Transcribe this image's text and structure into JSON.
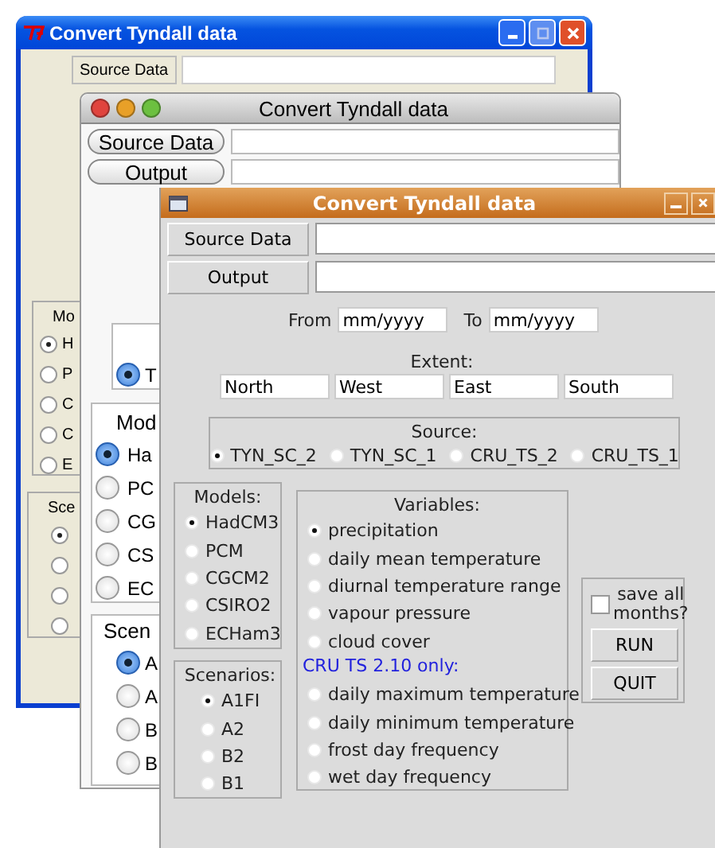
{
  "xp_window": {
    "title": "Convert Tyndall data",
    "source_button": "Source Data",
    "models": {
      "title": "Mo",
      "options": [
        {
          "label": "H",
          "selected": true
        },
        {
          "label": "P",
          "selected": false
        },
        {
          "label": "C",
          "selected": false
        },
        {
          "label": "C",
          "selected": false
        },
        {
          "label": "E",
          "selected": false
        }
      ]
    },
    "scenarios": {
      "title": "Sce",
      "options": [
        {
          "selected": true
        },
        {
          "selected": false
        },
        {
          "selected": false
        },
        {
          "selected": false
        }
      ]
    }
  },
  "mac_window": {
    "title": "Convert Tyndall data",
    "source_button": "Source Data",
    "output_button": "Output",
    "source": {
      "options": [
        {
          "label": "T",
          "selected": true
        }
      ]
    },
    "models": {
      "title": "Mod",
      "options": [
        {
          "label": "Ha",
          "selected": true
        },
        {
          "label": "PC",
          "selected": false
        },
        {
          "label": "CG",
          "selected": false
        },
        {
          "label": "CS",
          "selected": false
        },
        {
          "label": "EC",
          "selected": false
        }
      ]
    },
    "scenarios": {
      "title": "Scen",
      "options": [
        {
          "label": "A",
          "selected": true
        },
        {
          "label": "A",
          "selected": false
        },
        {
          "label": "B",
          "selected": false
        },
        {
          "label": "B",
          "selected": false
        }
      ]
    }
  },
  "main_window": {
    "title": "Convert Tyndall data",
    "source_button": "Source Data",
    "output_button": "Output",
    "from_label": "From",
    "from_value": "mm/yyyy",
    "to_label": "To",
    "to_value": "mm/yyyy",
    "extent": {
      "title": "Extent:",
      "fields": [
        "North",
        "West",
        "East",
        "South"
      ]
    },
    "source": {
      "title": "Source:",
      "options": [
        {
          "label": "TYN_SC_2",
          "selected": true
        },
        {
          "label": "TYN_SC_1",
          "selected": false
        },
        {
          "label": "CRU_TS_2",
          "selected": false
        },
        {
          "label": "CRU_TS_1",
          "selected": false
        }
      ]
    },
    "models": {
      "title": "Models:",
      "options": [
        {
          "label": "HadCM3",
          "selected": true
        },
        {
          "label": "PCM",
          "selected": false
        },
        {
          "label": "CGCM2",
          "selected": false
        },
        {
          "label": "CSIRO2",
          "selected": false
        },
        {
          "label": "ECHam3",
          "selected": false
        }
      ]
    },
    "scenarios": {
      "title": "Scenarios:",
      "options": [
        {
          "label": "A1FI",
          "selected": true
        },
        {
          "label": "A2",
          "selected": false
        },
        {
          "label": "B2",
          "selected": false
        },
        {
          "label": "B1",
          "selected": false
        }
      ]
    },
    "variables": {
      "title": "Variables:",
      "options": [
        {
          "label": "precipitation",
          "selected": true
        },
        {
          "label": "daily mean temperature",
          "selected": false
        },
        {
          "label": "diurnal temperature range",
          "selected": false
        },
        {
          "label": "vapour pressure",
          "selected": false
        },
        {
          "label": "cloud cover",
          "selected": false
        }
      ],
      "note": "CRU TS 2.10 only:",
      "extra_options": [
        {
          "label": "daily maximum temperature",
          "selected": false
        },
        {
          "label": "daily minimum temperature",
          "selected": false
        },
        {
          "label": "frost day frequency",
          "selected": false
        },
        {
          "label": "wet day frequency",
          "selected": false
        }
      ]
    },
    "save_all": {
      "label": "save all months?",
      "checked": false
    },
    "actions": [
      "RUN",
      "QUIT"
    ]
  }
}
